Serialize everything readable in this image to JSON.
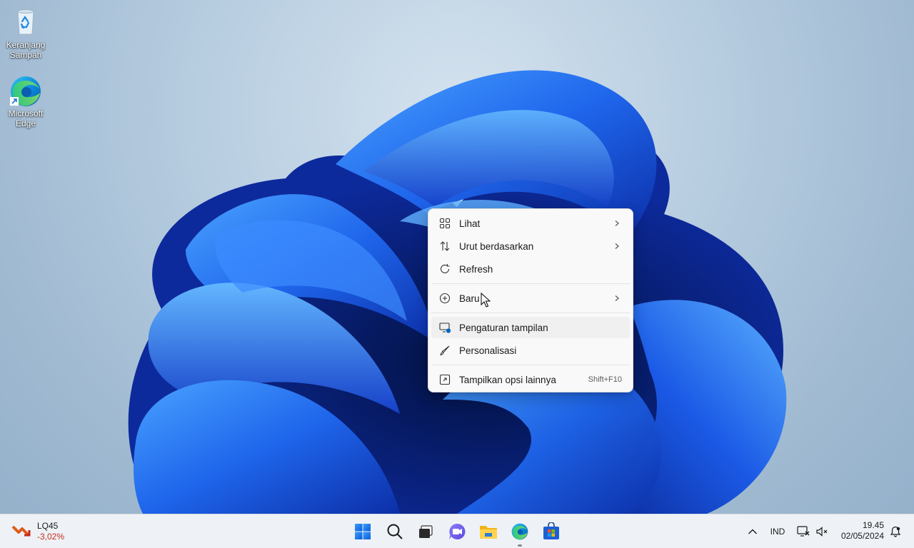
{
  "desktop": {
    "icons": [
      {
        "label": "Keranjang Sampah",
        "icon": "recycle-bin-icon"
      },
      {
        "label": "Microsoft Edge",
        "icon": "edge-icon"
      }
    ]
  },
  "context_menu": {
    "items": [
      {
        "label": "Lihat",
        "icon": "grid-icon",
        "has_submenu": true
      },
      {
        "label": "Urut berdasarkan",
        "icon": "sort-icon",
        "has_submenu": true
      },
      {
        "label": "Refresh",
        "icon": "refresh-icon"
      },
      {
        "label": "Baru",
        "icon": "plus-circle-icon",
        "has_submenu": true
      },
      {
        "label": "Pengaturan tampilan",
        "icon": "display-settings-icon"
      },
      {
        "label": "Personalisasi",
        "icon": "brush-icon"
      },
      {
        "label": "Tampilkan opsi lainnya",
        "icon": "more-options-icon",
        "shortcut": "Shift+F10"
      }
    ]
  },
  "taskbar": {
    "widget": {
      "name": "LQ45",
      "value": "-3,02%"
    },
    "apps": [
      "start-icon",
      "search-icon",
      "task-view-icon",
      "chat-icon",
      "file-explorer-icon",
      "edge-icon",
      "store-icon"
    ],
    "tray": {
      "language": "IND",
      "time": "19.45",
      "date": "02/05/2024"
    }
  },
  "colors": {
    "accent": "#0067c0",
    "wallpaper_blue": "#1f5fe0",
    "negative": "#c42b1c"
  }
}
